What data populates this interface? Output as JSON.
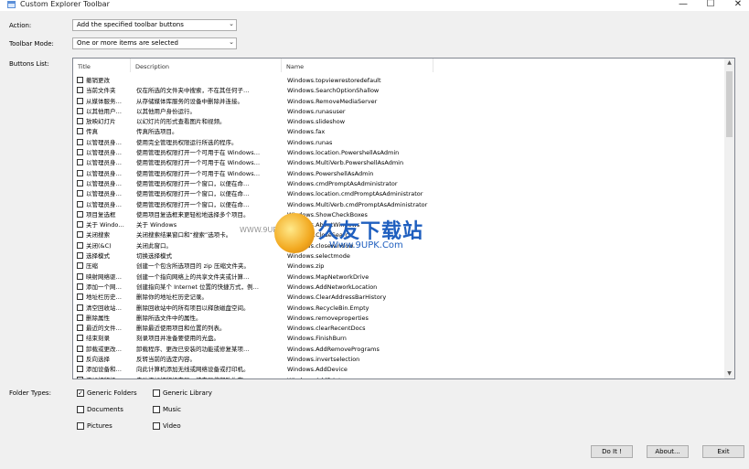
{
  "window": {
    "title": "Custom Explorer Toolbar",
    "min_glyph": "—",
    "max_glyph": "☐",
    "close_glyph": "✕"
  },
  "action": {
    "label": "Action:",
    "value": "Add the specified toolbar buttons",
    "arrow": "⌄"
  },
  "toolbar_mode": {
    "label": "Toolbar Mode:",
    "value": "One or more items are selected",
    "arrow": "⌄"
  },
  "buttons_list": {
    "label": "Buttons List:",
    "columns": [
      "Title",
      "Description",
      "Name"
    ],
    "scroll_up": "▲",
    "scroll_down": "▼",
    "rows": [
      {
        "title": "撤销更改",
        "desc": "",
        "name": "Windows.topviewrestoredefault"
      },
      {
        "title": "当前文件夹",
        "desc": "仅在所选的文件夹中搜索，不在其任何子…",
        "name": "Windows.SearchOptionShallow"
      },
      {
        "title": "从媒体服务…",
        "desc": "从存储媒体库服务的设备中删除并连接。",
        "name": "Windows.RemoveMediaServer"
      },
      {
        "title": "以其他用户…",
        "desc": "以其他用户身份运行。",
        "name": "Windows.runasuser"
      },
      {
        "title": "放映幻灯片",
        "desc": "以幻灯片的形式查看图片和视频。",
        "name": "Windows.slideshow"
      },
      {
        "title": "传真",
        "desc": "传真所选项目。",
        "name": "Windows.fax"
      },
      {
        "title": "以管理员身…",
        "desc": "使用完全管理员权限运行所选的程序。",
        "name": "Windows.runas"
      },
      {
        "title": "以管理员身…",
        "desc": "使用管理员权限打开一个可用于在 Windows…",
        "name": "Windows.location.PowershellAsAdmin"
      },
      {
        "title": "以管理员身…",
        "desc": "使用管理员权限打开一个可用于在 Windows…",
        "name": "Windows.MultiVerb.PowershellAsAdmin"
      },
      {
        "title": "以管理员身…",
        "desc": "使用管理员权限打开一个可用于在 Windows…",
        "name": "Windows.PowershellAsAdmin"
      },
      {
        "title": "以管理员身…",
        "desc": "使用管理员权限打开一个窗口，以便在命…",
        "name": "Windows.cmdPromptAsAdministrator"
      },
      {
        "title": "以管理员身…",
        "desc": "使用管理员权限打开一个窗口，以便在命…",
        "name": "Windows.location.cmdPromptAsAdministrator"
      },
      {
        "title": "以管理员身…",
        "desc": "使用管理员权限打开一个窗口，以便在命…",
        "name": "Windows.MultiVerb.cmdPromptAsAdministrator"
      },
      {
        "title": "项目复选框",
        "desc": "使用项目复选框来更轻松地选择多个项目。",
        "name": "Windows.ShowCheckBoxes"
      },
      {
        "title": "关于 Windo…",
        "desc": "关于 Windows",
        "name": "Windows.AboutWindows"
      },
      {
        "title": "关闭搜索",
        "desc": "关闭搜索结果窗口和“搜索”选项卡。",
        "name": "Windows.CloseSearch"
      },
      {
        "title": "关闭(&C)",
        "desc": "关闭此窗口。",
        "name": "Windows.closewindow"
      },
      {
        "title": "选择模式",
        "desc": "切换选择模式",
        "name": "Windows.selectmode"
      },
      {
        "title": "压缩",
        "desc": "创建一个包含所选项目的 zip 压缩文件夹。",
        "name": "Windows.zip"
      },
      {
        "title": "映射网络驱…",
        "desc": "创建一个指向网络上的共享文件夹或计算…",
        "name": "Windows.MapNetworkDrive"
      },
      {
        "title": "添加一个网…",
        "desc": "创建指向某个 Internet 位置的快捷方式，例…",
        "name": "Windows.AddNetworkLocation"
      },
      {
        "title": "地址栏历史…",
        "desc": "删除你的地址栏历史记录。",
        "name": "Windows.ClearAddressBarHistory"
      },
      {
        "title": "清空回收站…",
        "desc": "删除回收站中的所有项目以释放磁盘空间。",
        "name": "Windows.RecycleBin.Empty"
      },
      {
        "title": "删除属性",
        "desc": "删除所选文件中的属性。",
        "name": "Windows.removeproperties"
      },
      {
        "title": "最近的文件…",
        "desc": "删除最近使用项目和位置的列表。",
        "name": "Windows.clearRecentDocs"
      },
      {
        "title": "结束刻录",
        "desc": "刻录项目并准备要使用的光盘。",
        "name": "Windows.FinishBurn"
      },
      {
        "title": "卸载或更改…",
        "desc": "卸载程序、更改已安装的功能或修复某项…",
        "name": "Windows.AddRemovePrograms"
      },
      {
        "title": "反向选择",
        "desc": "反转当前的选定内容。",
        "name": "Windows.invertselection"
      },
      {
        "title": "添加设备和…",
        "desc": "向此计算机添加无线或网络设备或打印机。",
        "name": "Windows.AddDevice"
      },
      {
        "title": "添加打印机",
        "desc": "启动添加打印机向导，该向导将帮助你在…",
        "name": "Windows.AddPrinter"
      }
    ]
  },
  "folder_types": {
    "label": "Folder Types:",
    "check_glyph": "✓",
    "options": [
      {
        "label": "Generic Folders",
        "checked": true
      },
      {
        "label": "Generic Library",
        "checked": false
      },
      {
        "label": "Documents",
        "checked": false
      },
      {
        "label": "Music",
        "checked": false
      },
      {
        "label": "Pictures",
        "checked": false
      },
      {
        "label": "Video",
        "checked": false
      }
    ]
  },
  "buttons": {
    "doit": "Do It !",
    "about": "About...",
    "exit": "Exit"
  },
  "watermark": {
    "big": "久友下载站",
    "small": "Www.9UPK.Com",
    "left": "WWW.9UP"
  }
}
